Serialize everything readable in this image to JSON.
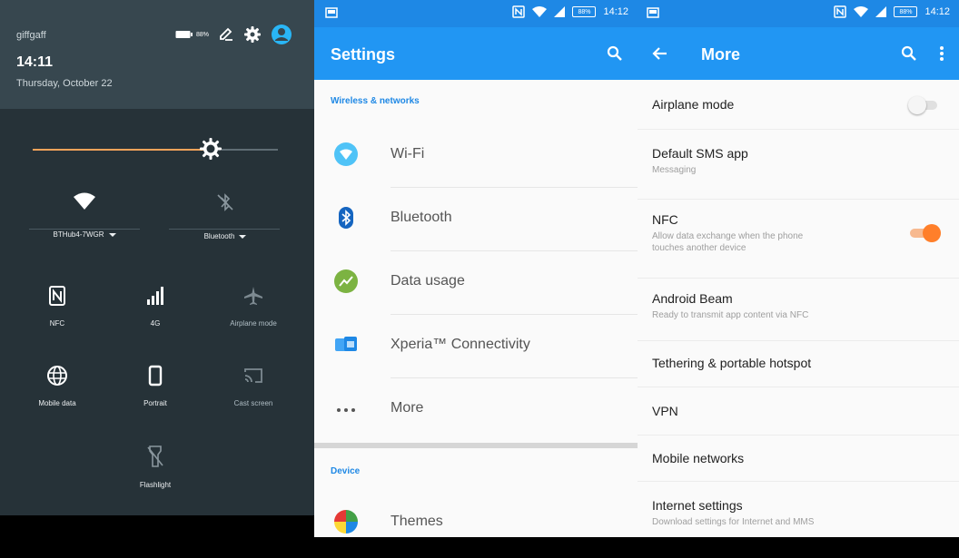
{
  "quick_settings": {
    "carrier": "giffgaff",
    "battery": "88%",
    "time": "14:11",
    "date": "Thursday, October 22",
    "wifi_network": "BTHub4-7WGR",
    "bluetooth_label": "Bluetooth",
    "tiles": [
      {
        "label": "NFC",
        "icon": "nfc-icon"
      },
      {
        "label": "4G",
        "icon": "signal-icon"
      },
      {
        "label": "Airplane mode",
        "icon": "airplane-icon"
      },
      {
        "label": "Mobile data",
        "icon": "globe-icon"
      },
      {
        "label": "Portrait",
        "icon": "portrait-icon"
      },
      {
        "label": "Cast screen",
        "icon": "cast-icon"
      },
      {
        "label": "Flashlight",
        "icon": "flashlight-icon"
      }
    ],
    "brightness_level": 0.68,
    "colors": {
      "panel": "#263238",
      "header": "#37474f",
      "accent": "#f5a35a",
      "user": "#29b6f6"
    }
  },
  "settings": {
    "title": "Settings",
    "status_time": "14:12",
    "status_battery": "88%",
    "section_wireless": "Wireless & networks",
    "section_device": "Device",
    "items": [
      {
        "label": "Wi-Fi",
        "icon": "wifi-icon"
      },
      {
        "label": "Bluetooth",
        "icon": "bluetooth-icon"
      },
      {
        "label": "Data usage",
        "icon": "data-usage-icon"
      },
      {
        "label": "Xperia™ Connectivity",
        "icon": "xperia-connectivity-icon"
      },
      {
        "label": "More",
        "icon": "more-dots-icon"
      },
      {
        "label": "Themes",
        "icon": "themes-icon"
      }
    ],
    "colors": {
      "toolbar": "#2196f3",
      "statusbar": "#1e88e5",
      "section": "#1e88e5"
    }
  },
  "more": {
    "title": "More",
    "status_time": "14:12",
    "status_battery": "88%",
    "items": [
      {
        "title": "Airplane mode",
        "toggle": false
      },
      {
        "title": "Default SMS app",
        "subtitle": "Messaging"
      },
      {
        "title": "NFC",
        "subtitle_line1": "Allow data exchange when the phone",
        "subtitle_line2": "touches another device",
        "toggle": true
      },
      {
        "title": "Android Beam",
        "subtitle": "Ready to transmit app content via NFC"
      },
      {
        "title": "Tethering & portable hotspot"
      },
      {
        "title": "VPN"
      },
      {
        "title": "Mobile networks"
      },
      {
        "title": "Internet settings",
        "subtitle": "Download settings for Internet and MMS"
      }
    ],
    "colors": {
      "toggle_on": "#ff7f2a",
      "toggle_on_track": "#f7b98f",
      "toggle_off": "#e0e0e0"
    }
  }
}
